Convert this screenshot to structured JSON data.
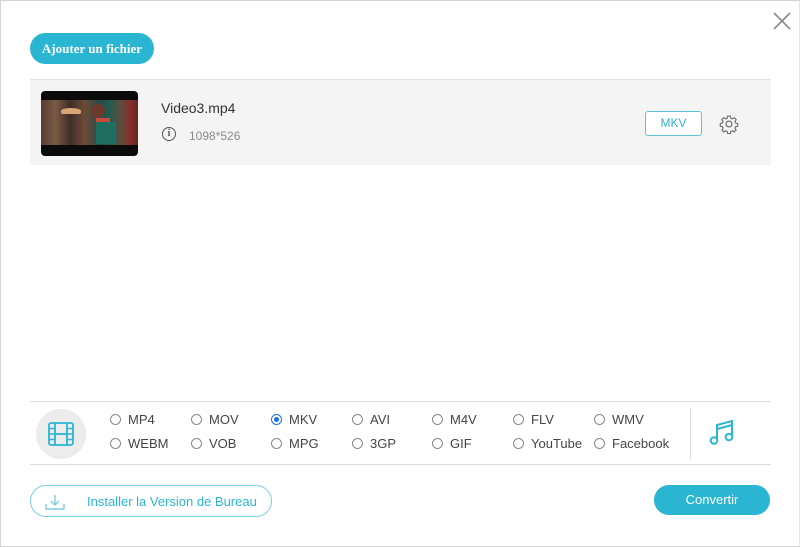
{
  "header": {
    "add_file_label": "Ajouter un fichier",
    "close_icon": "close-icon"
  },
  "file": {
    "name": "Video3.mp4",
    "resolution": "1098*526",
    "output_format": "MKV",
    "info_icon": "info-icon",
    "settings_icon": "gear-icon"
  },
  "formats": {
    "selected": "MKV",
    "row1": [
      "MP4",
      "MOV",
      "MKV",
      "AVI",
      "M4V",
      "FLV",
      "WMV"
    ],
    "row2": [
      "WEBM",
      "VOB",
      "MPG",
      "3GP",
      "GIF",
      "YouTube",
      "Facebook"
    ],
    "video_tab_icon": "film-icon",
    "audio_tab_icon": "music-note-icon"
  },
  "footer": {
    "install_label": "Installer la Version de Bureau",
    "convert_label": "Convertir"
  },
  "colors": {
    "accent": "#2ab6d3",
    "radio_selected": "#1a73e8"
  }
}
